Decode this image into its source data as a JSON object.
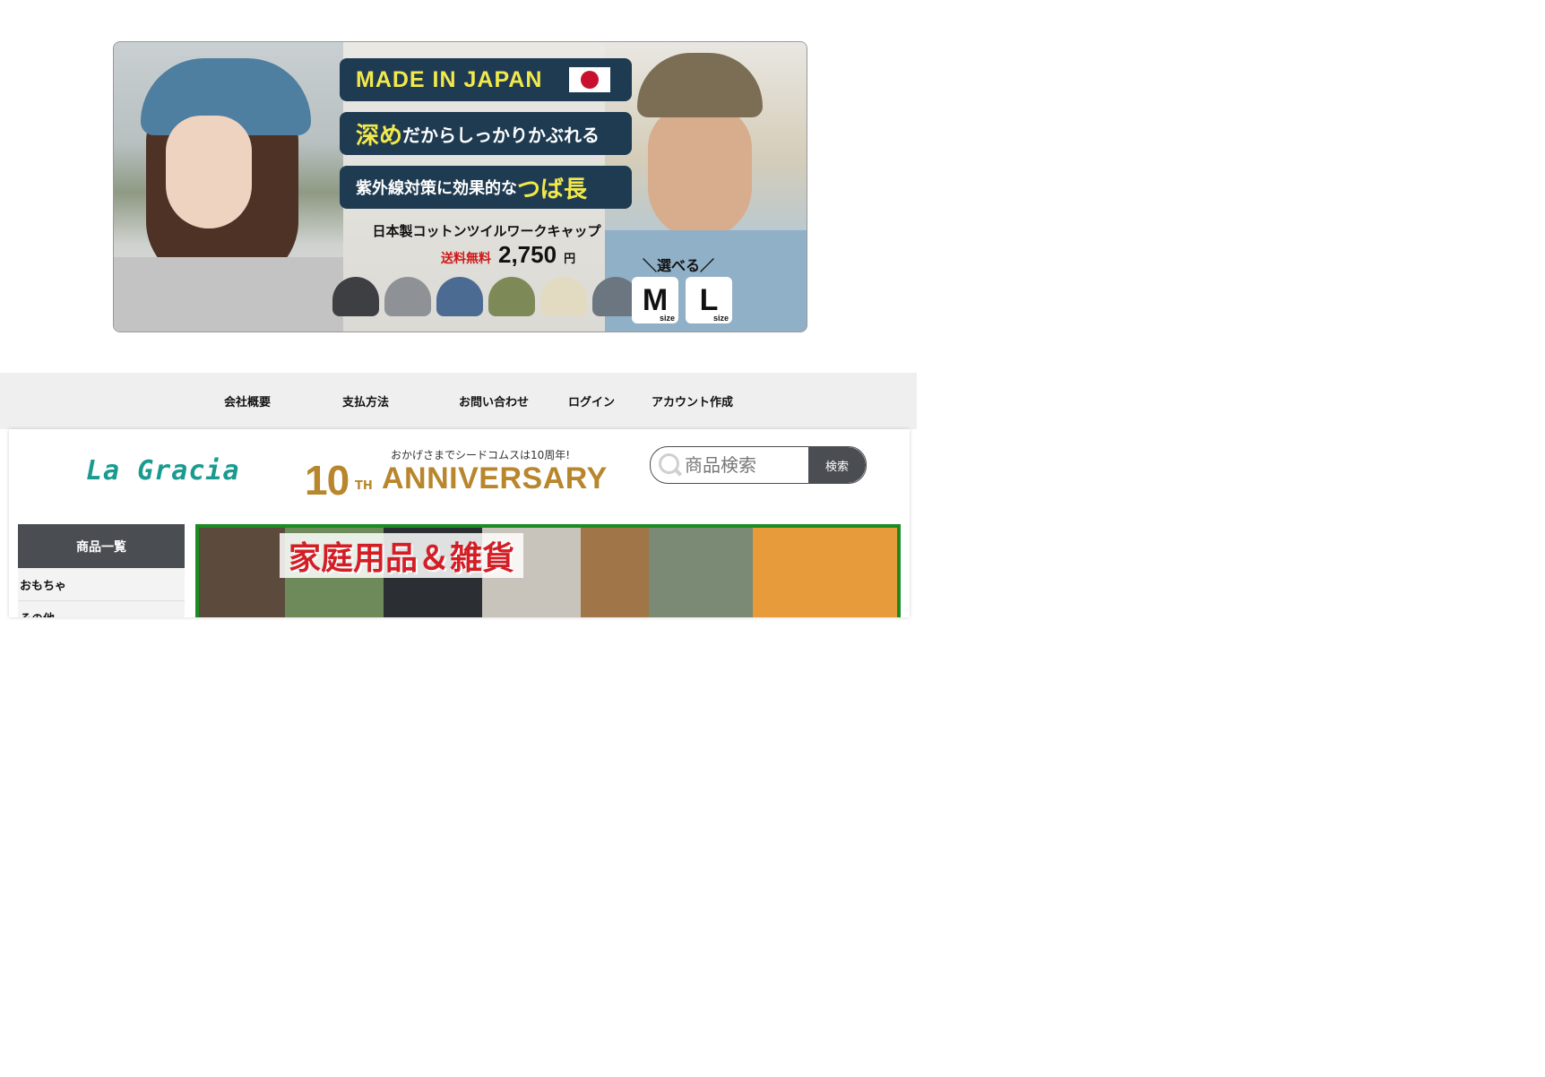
{
  "promo": {
    "badge_made_in": "MADE IN JAPAN",
    "line2_highlight": "深め",
    "line2_rest": "だからしっかりかぶれる",
    "line3_rest": "紫外線対策に効果的な",
    "line3_highlight": "つば長",
    "product_name": "日本製コットンツイルワークキャップ",
    "free_shipping": "送料無料",
    "price": "2,750",
    "price_unit": "円",
    "choose_label": "＼選べる／",
    "sizes": [
      "M",
      "L"
    ],
    "size_suffix": "size",
    "cap_colors": [
      "#3d3f42",
      "#8e9296",
      "#4b6b93",
      "#7d8a58",
      "#e2dbc2",
      "#6c7680"
    ]
  },
  "nav": {
    "items": [
      "会社概要",
      "支払方法",
      "お問い合わせ",
      "ログイン",
      "アカウント作成"
    ]
  },
  "header": {
    "logo_text": "La Gracia",
    "anniversary_thanks": "おかげさまでシードコムスは10周年!",
    "anniversary_number": "10",
    "anniversary_suffix": "TH",
    "anniversary_word": "ANNIVERSARY",
    "search_placeholder": "商品検索",
    "search_button": "検索"
  },
  "sidebar": {
    "heading": "商品一覧",
    "items": [
      "おもちゃ",
      "その他"
    ]
  },
  "category_banner": {
    "title": "家庭用品＆雑貨"
  },
  "colors": {
    "dark_gray": "#4a4d52",
    "nav_bg": "#efefef",
    "logo_teal": "#1a9b8f",
    "gold": "#b8862c",
    "banner_border_green": "#1a8c22"
  }
}
